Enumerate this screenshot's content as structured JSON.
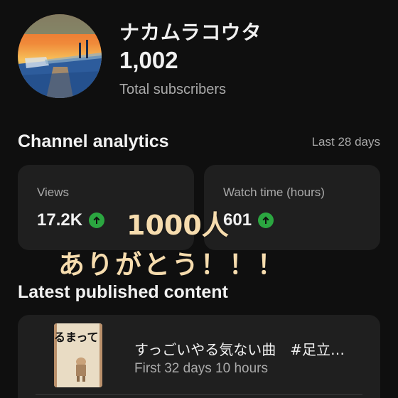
{
  "channel": {
    "name": "ナカムラコウタ",
    "subscriber_count": "1,002",
    "subscriber_label": "Total subscribers"
  },
  "analytics": {
    "title": "Channel analytics",
    "range": "Last 28 days",
    "cards": [
      {
        "label": "Views",
        "value": "17.2K",
        "trend_icon": "arrow-up-circle-icon"
      },
      {
        "label": "Watch time (hours)",
        "value": "601",
        "trend_icon": "arrow-up-circle-icon"
      }
    ]
  },
  "overlay": {
    "milestone": "1000人",
    "thanks": "ありがとう！！！"
  },
  "latest": {
    "title": "Latest published content",
    "video": {
      "thumbnail_text": "るまって",
      "title": "すっごいやる気ない曲　#足立…",
      "meta": "First 32 days 10 hours"
    }
  },
  "colors": {
    "background": "#0f0f0f",
    "card": "#1f1f1f",
    "trend_up": "#2ba640",
    "overlay_text": "#f6dcae"
  }
}
